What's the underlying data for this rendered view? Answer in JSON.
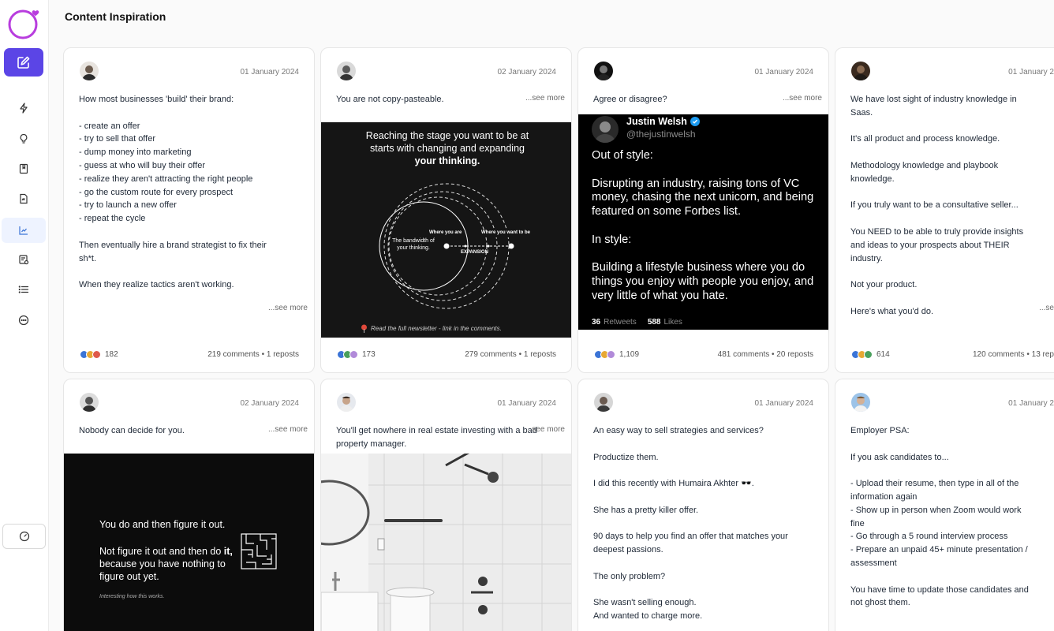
{
  "page": {
    "title": "Content Inspiration"
  },
  "colors": {
    "accent": "#5b45e6",
    "logo": "#b83dde",
    "like": "#3b74d6",
    "celebrate": "#4aa05d",
    "love": "#df5a4b",
    "support": "#b18ad9",
    "insight": "#e7a834"
  },
  "sidebar": {
    "logo_icon": "ring-heart-logo",
    "compose_icon": "pencil-square-icon",
    "items": [
      {
        "icon": "lightning-icon"
      },
      {
        "icon": "lightbulb-icon"
      },
      {
        "icon": "bookmark-icon"
      },
      {
        "icon": "document-icon"
      },
      {
        "icon": "chart-icon",
        "active": true
      },
      {
        "icon": "schedule-icon"
      },
      {
        "icon": "list-icon"
      },
      {
        "icon": "chat-icon"
      }
    ],
    "footer_icon": "speedometer-icon"
  },
  "cards": [
    {
      "date": "01 January 2024",
      "text": "How most businesses 'build' their brand:\n\n- create an offer\n- try to sell that offer\n- dump money into marketing\n- guess at who will buy their offer\n- realize they aren't attracting the right people\n- go the custom route for every prospect\n- try to launch a new offer\n- repeat the cycle\n\nThen eventually hire a brand strategist to fix their sh*t.\n\nWhen they realize tactics aren't working.",
      "see_more": "...see more",
      "reactions_count": "182",
      "stats": "219 comments • 1 reposts"
    },
    {
      "date": "02 January 2024",
      "text": "You are not copy-pasteable.",
      "see_more": "...see more",
      "media": {
        "heading_a": "Reaching the stage you want to be at starts with changing and expanding",
        "heading_b": "your thinking.",
        "inner_label": "The bandwidth of your thinking.",
        "label_where_you_are": "Where you are",
        "label_where_you_want": "Where you want to be",
        "label_expansion": "EXPANSION",
        "footer": "Read the full newsletter - link in the comments."
      },
      "reactions_count": "173",
      "stats": "279 comments • 1 reposts"
    },
    {
      "date": "01 January 2024",
      "text": "Agree or disagree?",
      "see_more": "...see more",
      "media": {
        "name": "Justin Welsh",
        "handle": "@thejustinwelsh",
        "body": "Out of style:\n\nDisrupting an industry, raising tons of VC money, chasing the next unicorn, and being featured on some Forbes list.\n\nIn style:\n\nBuilding a lifestyle business where you do things you enjoy with people you enjoy, and very little of what you hate.",
        "retweets_count": "36",
        "retweets_label": "Retweets",
        "likes_count": "588",
        "likes_label": "Likes"
      },
      "reactions_count": "1,109",
      "stats": "481 comments • 20 reposts"
    },
    {
      "date": "01 January 2",
      "text": "We have lost sight of industry knowledge in Saas.\n\nIt's all product and process knowledge.\n\nMethodology knowledge and playbook knowledge.\n\nIf you truly want to be a consultative seller...\n\nYou NEED to be able to truly provide insights and ideas to your prospects about THEIR industry.\n\nNot your product.\n\nHere's what you'd do.",
      "see_more": "...se",
      "reactions_count": "614",
      "stats": "120 comments • 13 rep"
    },
    {
      "date": "02 January 2024",
      "text": "Nobody can decide for you.",
      "see_more": "...see more",
      "media": {
        "line1": "You do and then figure it out.",
        "line2a": "Not figure it out and then do",
        "line2b": "it,",
        "line2c": "because you have nothing to figure out yet.",
        "caption": "Interesting how this works."
      }
    },
    {
      "date": "01 January 2024",
      "text": "You'll get nowhere in real estate investing with a bad property manager.",
      "see_more": "...see more"
    },
    {
      "date": "01 January 2024",
      "text": "An easy way to sell strategies and services?\n\nProductize them.\n\nI did this recently with Humaira Akhter 🕶️.\n\nShe has a pretty killer offer.\n\n90 days to help you find an offer that matches your deepest passions.\n\nThe only problem?\n\nShe wasn't selling enough.\nAnd wanted to charge more."
    },
    {
      "date": "01 January 2",
      "text": "Employer PSA:\n\nIf you ask candidates to...\n\n- Upload their resume, then type in all of the information again\n- Show up in person when Zoom would work fine\n- Go through a 5 round interview process\n- Prepare an unpaid 45+ minute presentation / assessment\n\nYou have time to update those candidates and not ghost them."
    }
  ]
}
